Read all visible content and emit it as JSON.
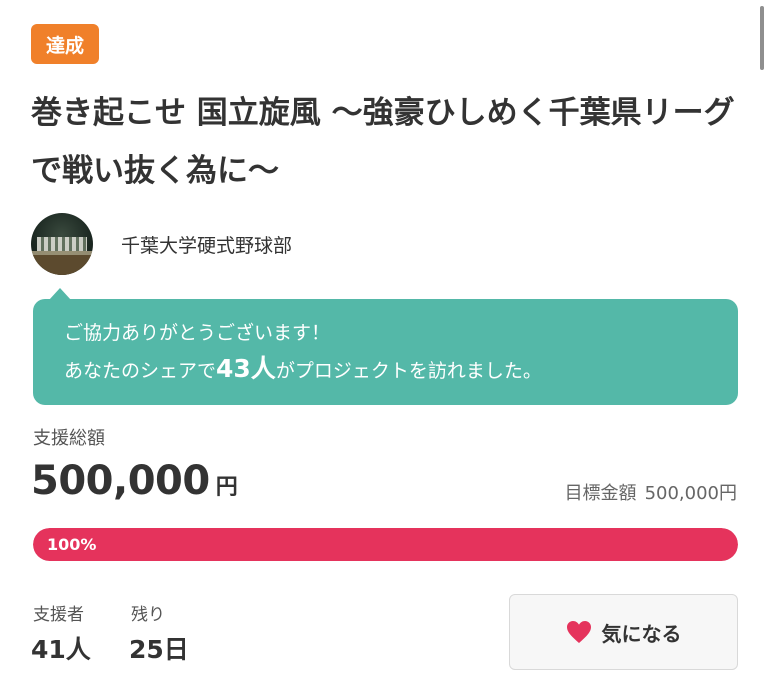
{
  "status_badge": "達成",
  "project": {
    "title": "巻き起こせ 国立旋風 ～強豪ひしめく千葉県リーグで戦い抜く為に～",
    "owner": "千葉大学硬式野球部"
  },
  "share_message": {
    "line1": "ご協力ありがとうございます！",
    "line2_prefix": "あなたのシェアで",
    "visitor_count": "43人",
    "line2_suffix": "がプロジェクトを訪れました。"
  },
  "funding": {
    "total_label": "支援総額",
    "total_amount": "500,000",
    "currency": "円",
    "goal_label": "目標金額",
    "goal_value": "500,000円",
    "progress_percent": 100,
    "progress_label": "100%"
  },
  "stats": {
    "supporters_label": "支援者",
    "supporters_value": "41人",
    "remaining_label": "残り",
    "remaining_value": "25日"
  },
  "favorite_button": {
    "label": "気になる",
    "icon": "heart-icon"
  },
  "colors": {
    "badge": "#f0802a",
    "share_bubble": "#54b8a8",
    "progress_fill": "#e5335c",
    "heart": "#e5335c"
  }
}
